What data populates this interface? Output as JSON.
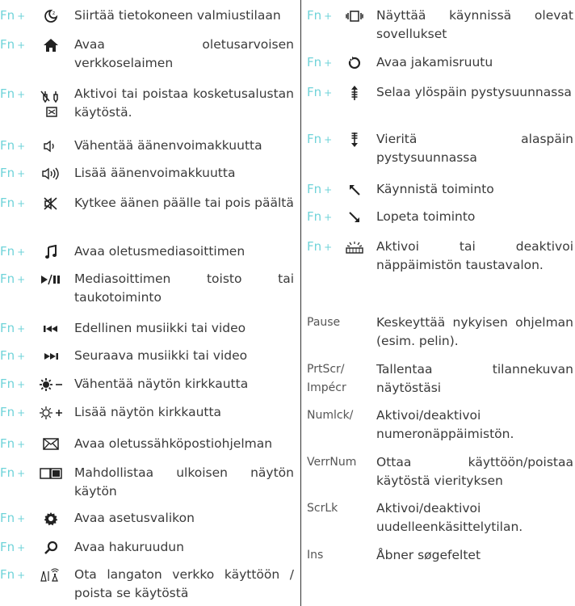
{
  "fn_label": "Fn",
  "plus": "+",
  "left": [
    {
      "icon": "sleep-icon",
      "text": "Siirtää tietokoneen valmiustilaan"
    },
    {
      "icon": "home-icon",
      "text": "Avaa oletusarvoisen verkkoselaimen"
    },
    {
      "icon": "touchpad-toggle-icon",
      "text": "Aktivoi tai poistaa kosketusalustan käytöstä."
    },
    {
      "icon": "volume-down-icon",
      "text": "Vähentää äänenvoimakkuutta"
    },
    {
      "icon": "volume-up-icon",
      "text": "Lisää äänenvoimakkuutta"
    },
    {
      "icon": "mute-icon",
      "text": "Kytkee äänen päälle tai pois päältä"
    },
    {
      "icon": "music-note-icon",
      "text": "Avaa oletusmediasoittimen"
    },
    {
      "icon": "play-pause-icon",
      "text": "Mediasoittimen toisto tai taukotoiminto"
    },
    {
      "icon": "previous-track-icon",
      "text": "Edellinen musiikki tai video"
    },
    {
      "icon": "next-track-icon",
      "text": "Seuraava musiikki tai video"
    },
    {
      "icon": "brightness-down-icon",
      "text": "Vähentää näytön kirkkautta"
    },
    {
      "icon": "brightness-up-icon",
      "text": "Lisää näytön kirkkautta"
    },
    {
      "icon": "mail-icon",
      "text": "Avaa oletussähköpostiohjelman"
    },
    {
      "icon": "external-display-icon",
      "text": "Mahdollistaa ulkoisen näytön käytön"
    },
    {
      "icon": "settings-gear-icon",
      "text": "Avaa asetusvalikon"
    },
    {
      "icon": "search-icon",
      "text": "Avaa hakuruudun"
    },
    {
      "icon": "wireless-toggle-icon",
      "text": "Ota langaton verkko käyttöön / poista se käytöstä"
    }
  ],
  "right": [
    {
      "icon": "running-apps-icon",
      "text": "Näyttää käynnissä olevat sovellukset"
    },
    {
      "icon": "share-icon",
      "text": "Avaa jakamisruutu"
    },
    {
      "icon": "scroll-up-icon",
      "text": "Selaa ylöspäin pystysuunnassa"
    },
    {
      "icon": "scroll-down-icon",
      "text": "Vieritä alaspäin pystysuunnassa"
    },
    {
      "icon": "start-arrow-icon",
      "text": "Käynnistä toiminto"
    },
    {
      "icon": "end-arrow-icon",
      "text": "Lopeta toiminto"
    },
    {
      "icon": "keyboard-backlight-icon",
      "text": "Aktivoi tai deaktivoi näppäimistön taustavalon."
    }
  ],
  "keys": [
    {
      "key": "Pause",
      "text": "Keskeyttää nykyisen ohjelman (esim. pelin)."
    },
    {
      "key": "PrtScr/ Impécr",
      "text": "Tallentaa tilannekuvan näytöstäsi"
    },
    {
      "key": "Numlck/",
      "text": "Aktivoi/deaktivoi numeronäppäimistön."
    },
    {
      "key": "VerrNum",
      "text": "Ottaa käyttöön/poistaa käytöstä vierityksen"
    },
    {
      "key": "ScrLk",
      "text": "Aktivoi/deaktivoi uudelleenkäsittelytilan."
    },
    {
      "key": "Ins",
      "text": "Åbner søgefeltet"
    }
  ]
}
